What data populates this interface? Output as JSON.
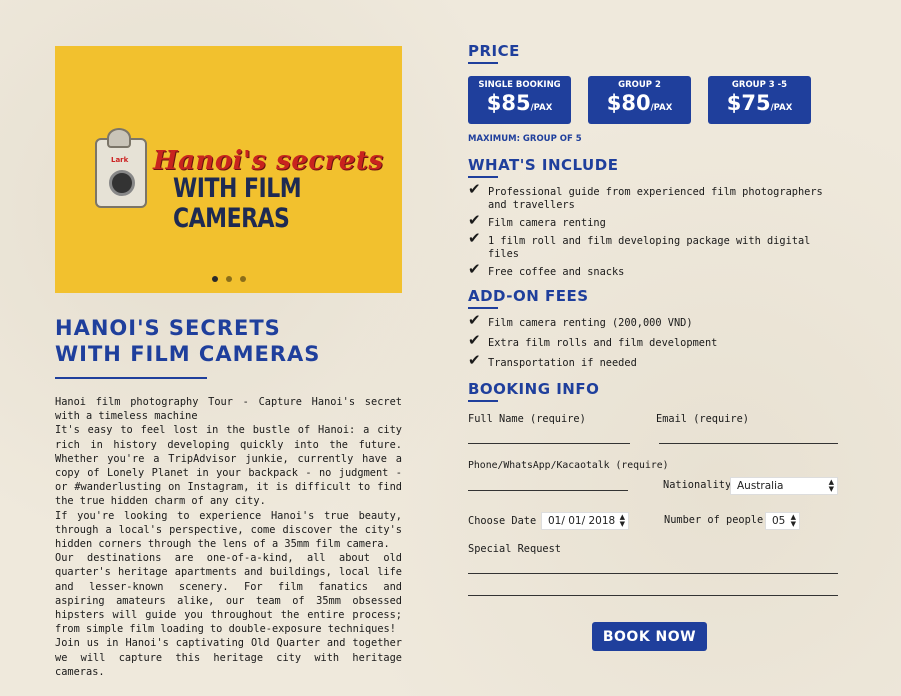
{
  "hero": {
    "title_line1": "Hanoi's secrets",
    "title_line2": "WITH FILM CAMERAS",
    "camera_brand": "Lark",
    "slides": 3,
    "active_slide": 1
  },
  "page_title_line1": "HANOI'S SECRETS",
  "page_title_line2": "WITH FILM CAMERAS",
  "description": [
    "Hanoi film photography Tour - Capture Hanoi's secret with a timeless machine",
    "It's easy to feel lost in the bustle of Hanoi: a city rich in history developing quickly into the future. Whether you're a TripAdvisor junkie, currently have a copy of Lonely Planet in your backpack - no judgment - or #wanderlusting on Instagram, it is difficult to find the true hidden charm of any city.",
    "If you're looking to experience Hanoi's true beauty, through a local's perspective, come discover the city's hidden corners through the lens of a 35mm film camera.",
    "Our destinations are one-of-a-kind, all about old quarter's heritage apartments and buildings, local life and lesser-known scenery. For film fanatics and aspiring amateurs alike, our team of 35mm obsessed hipsters will guide you throughout the entire process; from simple film loading to double-exposure techniques!",
    "Join us in Hanoi's captivating Old Quarter and together we will capture this heritage city with heritage cameras."
  ],
  "price": {
    "heading": "PRICE",
    "boxes": [
      {
        "label": "SINGLE BOOKING",
        "amount": "$85",
        "unit": "/PAX"
      },
      {
        "label": "GROUP 2",
        "amount": "$80",
        "unit": "/PAX"
      },
      {
        "label": "GROUP 3 -5",
        "amount": "$75",
        "unit": "/PAX"
      }
    ],
    "max_note": "MAXIMUM: GROUP OF 5"
  },
  "includes": {
    "heading": "WHAT'S INCLUDE",
    "items": [
      "Professional guide from experienced film photographers and travellers",
      "Film camera renting",
      "1 film roll and film developing package with digital files",
      "Free coffee and snacks"
    ]
  },
  "addons": {
    "heading": "ADD-ON FEES",
    "items": [
      "Film camera renting (200,000 VND)",
      "Extra film rolls and film development",
      "Transportation if needed"
    ]
  },
  "booking": {
    "heading": "BOOKING INFO",
    "full_name_label": "Full Name (require)",
    "email_label": "Email (require)",
    "phone_label": "Phone/WhatsApp/Kacaotalk (require)",
    "nationality_label": "Nationality",
    "nationality_value": "Australia",
    "date_label": "Choose Date",
    "date_value": "01/ 01/ 2018",
    "people_label": "Number of people",
    "people_value": "05",
    "special_label": "Special Request",
    "submit_label": "BOOK NOW"
  },
  "colors": {
    "accent": "#1f3f9c",
    "hero_bg": "#f2c12e",
    "hero_title": "#c8241e"
  }
}
